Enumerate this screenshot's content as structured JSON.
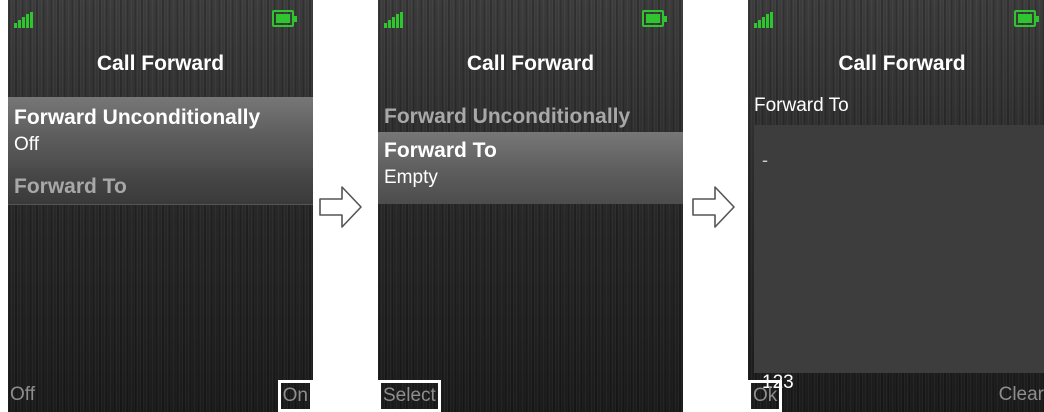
{
  "screens": [
    {
      "title": "Call Forward",
      "items": [
        {
          "name": "Forward Unconditionally",
          "value": "Off"
        },
        {
          "name": "Forward To"
        }
      ],
      "softkeys": {
        "left": "Off",
        "right": "On"
      }
    },
    {
      "title": "Call Forward",
      "items": [
        {
          "name": "Forward Unconditionally"
        },
        {
          "name": "Forward To",
          "value": "Empty"
        }
      ],
      "softkeys": {
        "left": "Select"
      }
    },
    {
      "title": "Call Forward",
      "field_label": "Forward To",
      "cursor": "-",
      "input_mode": "123",
      "softkeys": {
        "left": "Ok",
        "right": "Clear"
      }
    }
  ],
  "colors": {
    "indicator_green": "#2ec52e",
    "highlight_gray": "#6a6a6a"
  },
  "icons": [
    "signal-icon",
    "battery-icon",
    "arrow-right-icon"
  ]
}
